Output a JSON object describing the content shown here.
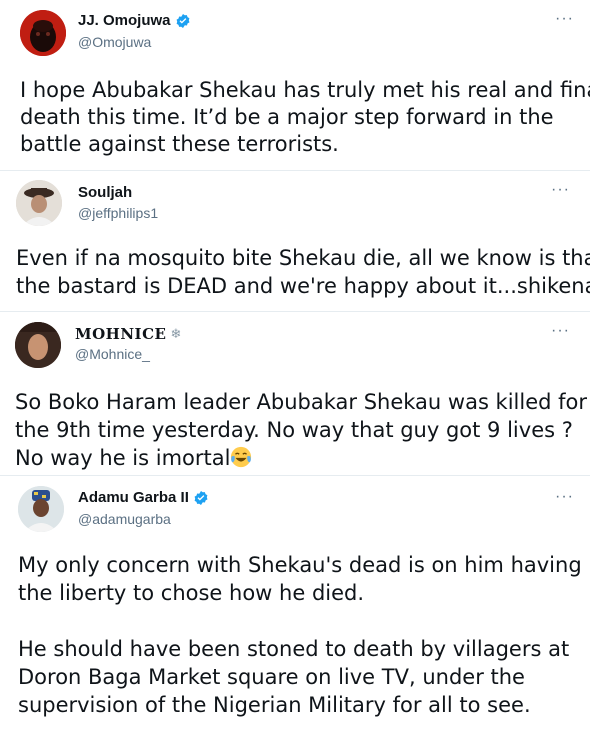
{
  "tweets": [
    {
      "name": "JJ. Omojuwa",
      "handle": "@Omojuwa",
      "verified": true,
      "lines": [
        "I hope Abubakar Shekau has truly met his real and final",
        "death this time. It’d be a major step forward in the",
        "battle against these terrorists."
      ]
    },
    {
      "name": "Souljah",
      "handle": "@jeffphilips1",
      "verified": false,
      "lines": [
        "Even if na mosquito bite Shekau die, all we know is that",
        "the bastard is DEAD and we're happy about it...shikena"
      ]
    },
    {
      "name": "MOHNICE",
      "name_suffix": "❄",
      "handle": "@Mohnice_",
      "verified": false,
      "lines": [
        "So Boko Haram leader Abubakar Shekau was killed for",
        "the 9th time yesterday. No way that guy got 9 lives ?",
        "No way he is imortal"
      ]
    },
    {
      "name": "Adamu Garba II",
      "handle": "@adamugarba",
      "verified": true,
      "lines": [
        "My only concern with Shekau's dead is on him having",
        "the liberty to chose how he died.",
        "He should have been stoned to death by villagers at",
        "Doron Baga Market square on live TV, under the",
        "supervision of the Nigerian Military for all to see."
      ]
    }
  ],
  "more_label": "···",
  "icons": {
    "verified": "verified-badge-icon",
    "more": "more-options-icon",
    "emoji": "tears-of-joy-emoji"
  },
  "colors": {
    "verified": "#1da1f2",
    "secondary_text": "#5b7083",
    "divider": "#e6ecf0"
  }
}
